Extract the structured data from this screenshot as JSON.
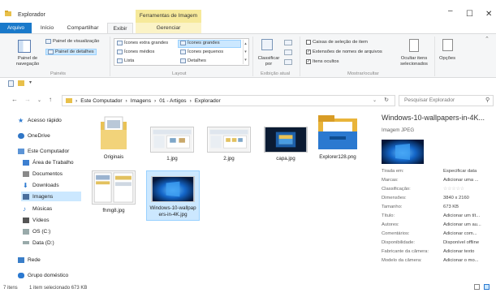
{
  "window": {
    "title": "Explorador",
    "context_tab_group": "Ferramentas de Imagem",
    "controls": {
      "minimize": "–",
      "maximize": "☐",
      "close": "✕"
    }
  },
  "ribbon_tabs": [
    "Arquivo",
    "Início",
    "Compartilhar",
    "Exibir",
    "Gerenciar"
  ],
  "ribbon": {
    "panes": {
      "nav_pane": "Painel de navegação",
      "preview_pane": "Painel de visualização",
      "details_pane": "Painel de detalhes",
      "label": "Painéis"
    },
    "layout": {
      "options": [
        "Ícones extra grandes",
        "Ícones grandes",
        "Ícones médios",
        "Ícones pequenos",
        "Lista",
        "Detalhes"
      ],
      "selected": "Ícones grandes",
      "label": "Layout"
    },
    "current_view": {
      "sort_by": "Classificar por",
      "label": "Exibição atual"
    },
    "show_hide": {
      "item_checkboxes": "Caixas de seleção de item",
      "extensions": "Extensões de nomes de arquivos",
      "hidden_items": "Itens ocultos",
      "hide_selected": "Ocultar itens selecionados",
      "options": "Opções",
      "label": "Mostrar/ocultar"
    }
  },
  "address": {
    "breadcrumb": [
      "Este Computador",
      "Imagens",
      "01 - Artigos",
      "Explorador"
    ],
    "search_placeholder": "Pesquisar Explorador"
  },
  "sidebar": [
    {
      "label": "Acesso rápido",
      "icon": "star-icon"
    },
    {
      "label": "OneDrive",
      "icon": "cloud-icon"
    },
    {
      "label": "Este Computador",
      "icon": "computer-icon"
    },
    {
      "label": "Área de Trabalho",
      "icon": "desktop-icon"
    },
    {
      "label": "Documentos",
      "icon": "documents-icon"
    },
    {
      "label": "Downloads",
      "icon": "download-icon"
    },
    {
      "label": "Imagens",
      "icon": "pictures-icon"
    },
    {
      "label": "Músicas",
      "icon": "music-icon"
    },
    {
      "label": "Vídeos",
      "icon": "video-icon"
    },
    {
      "label": "OS (C:)",
      "icon": "drive-icon"
    },
    {
      "label": "Data (D:)",
      "icon": "drive-icon"
    },
    {
      "label": "Rede",
      "icon": "network-icon"
    },
    {
      "label": "Grupo doméstico",
      "icon": "homegroup-icon"
    }
  ],
  "files": [
    {
      "name": "Originais",
      "kind": "folder"
    },
    {
      "name": "1.jpg",
      "kind": "image"
    },
    {
      "name": "2.jpg",
      "kind": "image"
    },
    {
      "name": "capa.jpg",
      "kind": "image"
    },
    {
      "name": "Explorer128.png",
      "kind": "image"
    },
    {
      "name": "fhmg8.jpg",
      "kind": "image"
    },
    {
      "name": "Windows-10-wallpapers-in-4K.jpg",
      "kind": "image",
      "selected": true
    }
  ],
  "details": {
    "title": "Windows-10-wallpapers-in-4K...",
    "type": "Imagem JPEG",
    "properties": [
      {
        "k": "Tirada em:",
        "v": "Especificar data"
      },
      {
        "k": "Marcas:",
        "v": "Adicionar uma ..."
      },
      {
        "k": "Classificação:",
        "v": "☆☆☆☆☆"
      },
      {
        "k": "Dimensões:",
        "v": "3840 x 2160"
      },
      {
        "k": "Tamanho:",
        "v": "673 KB"
      },
      {
        "k": "Título:",
        "v": "Adicionar um tít..."
      },
      {
        "k": "Autores:",
        "v": "Adicionar um au..."
      },
      {
        "k": "Comentários:",
        "v": "Adicionar com..."
      },
      {
        "k": "Disponibilidade:",
        "v": "Disponível offline"
      },
      {
        "k": "Fabricante da câmera:",
        "v": "Adicionar texto"
      },
      {
        "k": "Modelo da câmera:",
        "v": "Adicionar o mo..."
      }
    ]
  },
  "status": {
    "items": "7 itens",
    "selection": "1 item selecionado 673 KB"
  },
  "colors": {
    "file_tab": "#1979ca",
    "selection": "#cce8ff",
    "context": "#f6e99a"
  }
}
